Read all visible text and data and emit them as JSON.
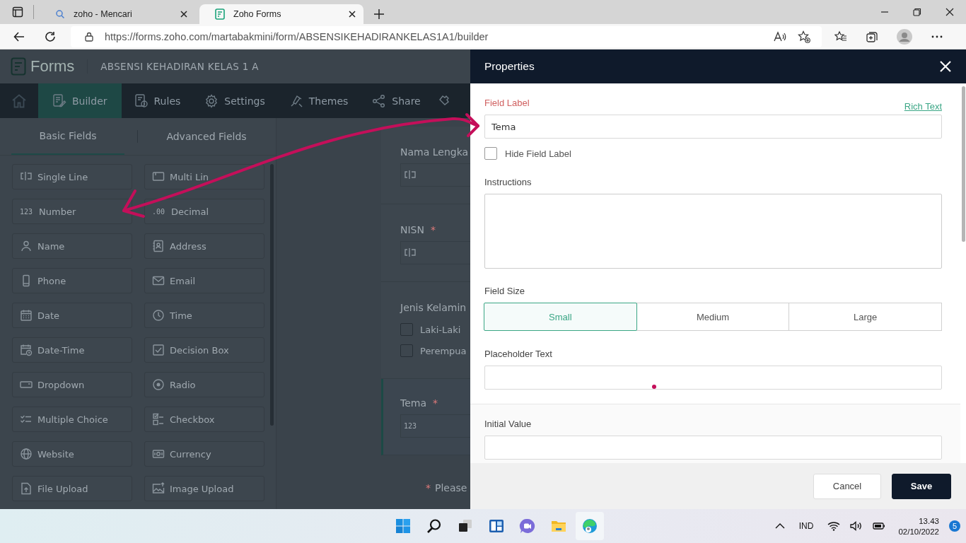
{
  "browser": {
    "tabs": [
      {
        "title": "zoho - Mencari",
        "selected": false,
        "kind": "search"
      },
      {
        "title": "Zoho Forms",
        "selected": true,
        "kind": "forms"
      }
    ],
    "url": "https://forms.zoho.com/martabakmini/form/ABSENSIKEHADIRANKELAS1A1/builder"
  },
  "app": {
    "brand": "Forms",
    "form_title": "ABSENSI KEHADIRAN KELAS 1 A",
    "nav": [
      {
        "label": "Builder",
        "selected": true
      },
      {
        "label": "Rules",
        "selected": false
      },
      {
        "label": "Settings",
        "selected": false
      },
      {
        "label": "Themes",
        "selected": false
      },
      {
        "label": "Share",
        "selected": false
      }
    ],
    "field_tabs": [
      {
        "label": "Basic Fields",
        "selected": true
      },
      {
        "label": "Advanced Fields",
        "selected": false
      }
    ],
    "fields": [
      {
        "label": "Single Line"
      },
      {
        "label": "Multi Lin"
      },
      {
        "label": "Number",
        "icon_text": "123"
      },
      {
        "label": "Decimal",
        "icon_text": ".00"
      },
      {
        "label": "Name"
      },
      {
        "label": "Address"
      },
      {
        "label": "Phone"
      },
      {
        "label": "Email"
      },
      {
        "label": "Date"
      },
      {
        "label": "Time"
      },
      {
        "label": "Date-Time"
      },
      {
        "label": "Decision Box"
      },
      {
        "label": "Dropdown"
      },
      {
        "label": "Radio"
      },
      {
        "label": "Multiple Choice"
      },
      {
        "label": "Checkbox"
      },
      {
        "label": "Website"
      },
      {
        "label": "Currency"
      },
      {
        "label": "File Upload"
      },
      {
        "label": "Image Upload"
      }
    ],
    "form_fields": [
      {
        "label": "Nama Lengka",
        "required": false,
        "kind": "text",
        "selected": false
      },
      {
        "label": "NISN",
        "required": true,
        "kind": "text",
        "selected": false
      },
      {
        "label": "Jenis Kelamin",
        "required": false,
        "kind": "checkbox",
        "selected": false,
        "options": [
          {
            "label": "Laki-Laki",
            "checked": false
          },
          {
            "label": "Perempua",
            "checked": false
          }
        ]
      },
      {
        "label": "Tema",
        "required": true,
        "kind": "number",
        "selected": true,
        "icon_text": "123"
      }
    ],
    "required_mark": "*",
    "required_note": "Please"
  },
  "properties": {
    "title": "Properties",
    "field_label": {
      "label": "Field Label",
      "value": "Tema"
    },
    "rich_text": "Rich Text",
    "hide_label": {
      "label": "Hide Field Label",
      "checked": false
    },
    "instructions": {
      "label": "Instructions"
    },
    "field_size": {
      "label": "Field Size",
      "options": [
        {
          "label": "Small",
          "selected": true
        },
        {
          "label": "Medium",
          "selected": false
        },
        {
          "label": "Large",
          "selected": false
        }
      ]
    },
    "placeholder_text": {
      "label": "Placeholder Text"
    },
    "initial_value": {
      "label": "Initial Value"
    },
    "buttons": [
      {
        "label": "Cancel",
        "kind": "secondary"
      },
      {
        "label": "Save",
        "kind": "primary"
      }
    ]
  },
  "taskbar": {
    "language": "IND",
    "time": "13.43",
    "date": "02/10/2022",
    "notifications": "5"
  }
}
